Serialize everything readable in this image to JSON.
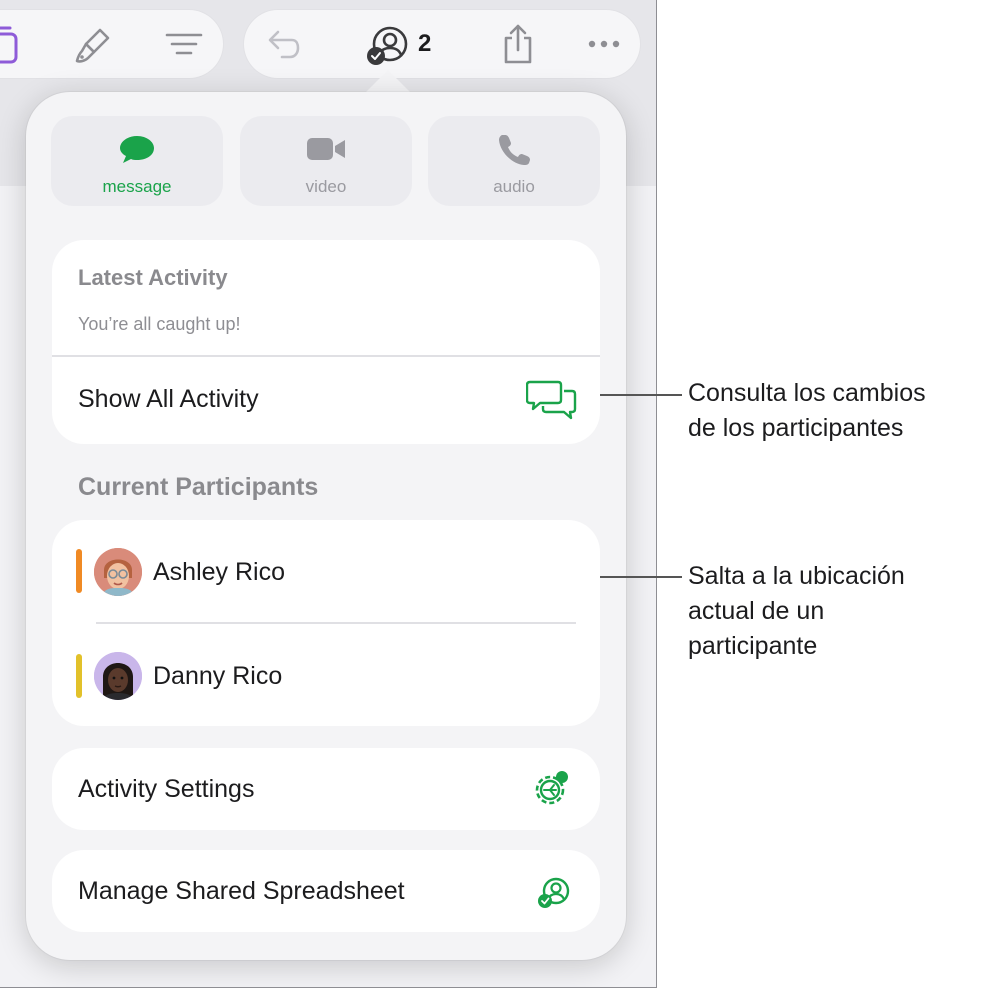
{
  "toolbar": {
    "left_icons": [
      "format-panel-icon",
      "paintbrush-icon",
      "organize-icon"
    ],
    "right_icons": [
      "undo-icon",
      "collaboration-icon",
      "share-icon",
      "more-icon"
    ],
    "collaborator_count": "2"
  },
  "popover": {
    "comm_buttons": [
      {
        "label": "message",
        "icon": "message-bubble-icon",
        "active": true
      },
      {
        "label": "video",
        "icon": "video-camera-icon",
        "active": false
      },
      {
        "label": "audio",
        "icon": "phone-icon",
        "active": false
      }
    ],
    "latest_activity": {
      "title": "Latest Activity",
      "status": "You’re all caught up!",
      "show_all_label": "Show All Activity"
    },
    "participants": {
      "title": "Current Participants",
      "people": [
        {
          "name": "Ashley Rico",
          "color": "#f08a24"
        },
        {
          "name": "Danny Rico",
          "color": "#e2c12a"
        }
      ]
    },
    "activity_settings_label": "Activity Settings",
    "manage_label": "Manage Shared Spreadsheet"
  },
  "callouts": [
    {
      "lines": [
        "Consulta los cambios",
        "de los participantes"
      ]
    },
    {
      "lines": [
        "Salta a la ubicación",
        "actual de un",
        "participante"
      ]
    }
  ],
  "colors": {
    "accent_green": "#1aa34a",
    "secondary_text": "#8a8a8e"
  }
}
